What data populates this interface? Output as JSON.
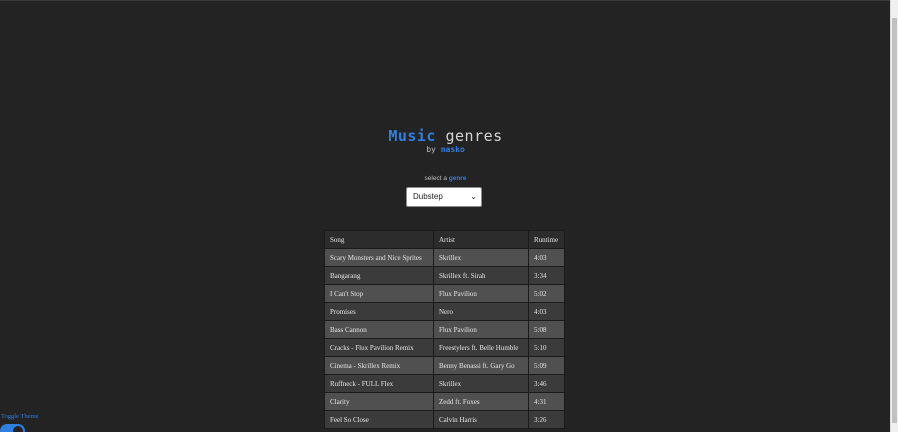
{
  "header": {
    "title_word1": "Music",
    "title_word2": "genres",
    "by": "by",
    "author": "nasko"
  },
  "selector": {
    "label_prefix": "select a",
    "label_highlight": "genre",
    "selected": "Dubstep",
    "icon": "chevron-down-icon"
  },
  "table": {
    "headers": [
      "Song",
      "Artist",
      "Runtime"
    ],
    "rows": [
      {
        "song": "Scary Monsters and Nice Sprites",
        "artist": "Skrillex",
        "runtime": "4:03"
      },
      {
        "song": "Bangarang",
        "artist": "Skrillex ft. Sirah",
        "runtime": "3:34"
      },
      {
        "song": "I Can't Stop",
        "artist": "Flux Pavilion",
        "runtime": "5:02"
      },
      {
        "song": "Promises",
        "artist": "Nero",
        "runtime": "4:03"
      },
      {
        "song": "Bass Cannon",
        "artist": "Flux Pavilion",
        "runtime": "5:08"
      },
      {
        "song": "Cracks - Flux Pavilion Remix",
        "artist": "Freestylers ft. Belle Humble",
        "runtime": "5:10"
      },
      {
        "song": "Cinema - Skrillex Remix",
        "artist": "Benny Benassi ft. Gary Go",
        "runtime": "5:09"
      },
      {
        "song": "Ruffneck - FULL Flex",
        "artist": "Skrillex",
        "runtime": "3:46"
      },
      {
        "song": "Clarity",
        "artist": "Zedd ft. Foxes",
        "runtime": "4:31"
      },
      {
        "song": "Feel So Close",
        "artist": "Calvin Harris",
        "runtime": "3:26"
      }
    ]
  },
  "theme": {
    "toggle_label": "Toggle Theme",
    "accent": "#2f7fe0",
    "background": "#232323"
  }
}
